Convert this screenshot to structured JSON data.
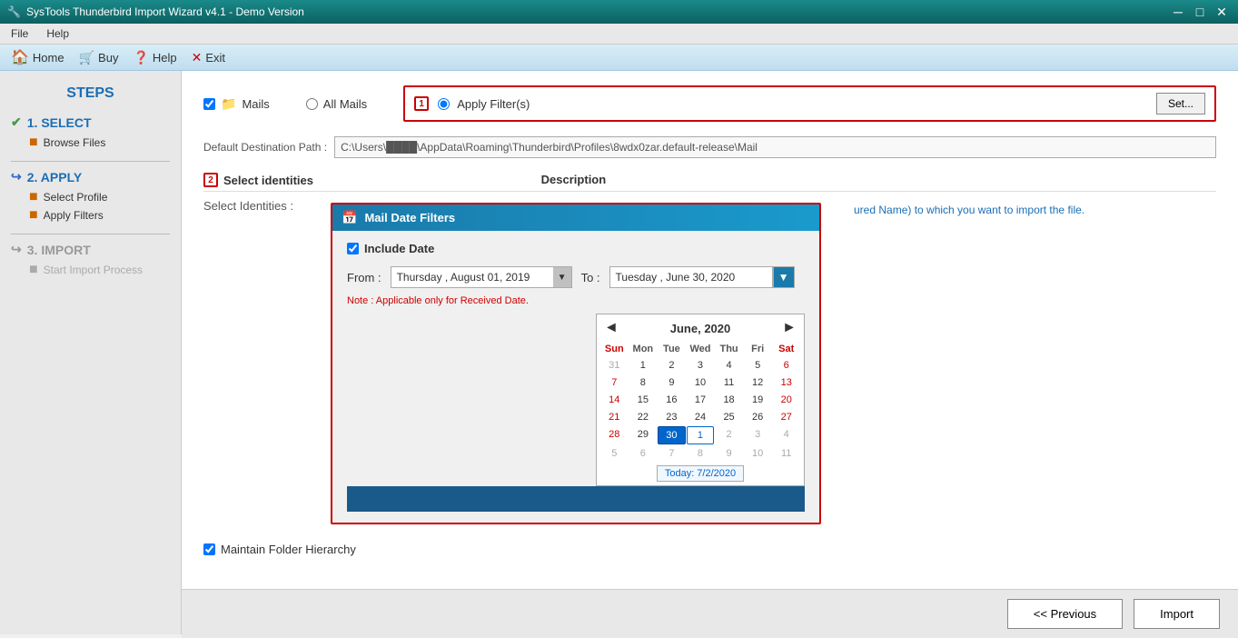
{
  "titleBar": {
    "title": "SysTools Thunderbird Import Wizard v4.1 - Demo Version",
    "controls": [
      "minimize",
      "maximize",
      "close"
    ]
  },
  "menuBar": {
    "items": [
      "File",
      "Help"
    ]
  },
  "toolbar": {
    "home_label": "Home",
    "buy_label": "Buy",
    "help_label": "Help",
    "exit_label": "Exit"
  },
  "sidebar": {
    "steps_title": "STEPS",
    "step1": {
      "number": "1.",
      "label": "SELECT",
      "sub_items": [
        "Browse Files"
      ]
    },
    "step2": {
      "number": "2.",
      "label": "APPLY",
      "sub_items": [
        "Select Profile",
        "Apply Filters"
      ]
    },
    "step3": {
      "number": "3.",
      "label": "IMPORT",
      "sub_items": [
        "Start Import Process"
      ]
    }
  },
  "content": {
    "options": {
      "mails_label": "Mails",
      "all_mails_label": "All Mails",
      "apply_filters_label": "Apply Filter(s)",
      "set_button_label": "Set...",
      "badge1": "1"
    },
    "path": {
      "label": "Default Destination Path :",
      "value": "C:\\Users\\████\\AppData\\Roaming\\Thunderbird\\Profiles\\8wdx0zar.default-release\\Mail"
    },
    "identities": {
      "col1": "Select identities",
      "col2": "Description",
      "badge2": "2",
      "select_identities_label": "Select Identities :",
      "description_text": "ured Name) to which you want to import the file."
    },
    "dialog": {
      "title": "Mail Date Filters",
      "include_date_label": "Include Date",
      "from_label": "From :",
      "from_value": "Thursday ,  August  01, 2019",
      "to_label": "To :",
      "to_value": "Tuesday ,  June  30, 2020",
      "note": "Note : Applicable only for Received Date.",
      "calendar": {
        "month_label": "June, 2020",
        "prev_arrow": "◄",
        "next_arrow": "►",
        "day_headers": [
          "Sun",
          "Mon",
          "Tue",
          "Wed",
          "Thu",
          "Fri",
          "Sat"
        ],
        "weeks": [
          [
            {
              "day": "31",
              "other": true
            },
            {
              "day": "1"
            },
            {
              "day": "2"
            },
            {
              "day": "3"
            },
            {
              "day": "4"
            },
            {
              "day": "5"
            },
            {
              "day": "6",
              "sat": true
            }
          ],
          [
            {
              "day": "7"
            },
            {
              "day": "8"
            },
            {
              "day": "9"
            },
            {
              "day": "10"
            },
            {
              "day": "11"
            },
            {
              "day": "12"
            },
            {
              "day": "13",
              "sat": true
            }
          ],
          [
            {
              "day": "14"
            },
            {
              "day": "15"
            },
            {
              "day": "16"
            },
            {
              "day": "17"
            },
            {
              "day": "18"
            },
            {
              "day": "19"
            },
            {
              "day": "20",
              "sat": true
            }
          ],
          [
            {
              "day": "21"
            },
            {
              "day": "22"
            },
            {
              "day": "23"
            },
            {
              "day": "24"
            },
            {
              "day": "25"
            },
            {
              "day": "26"
            },
            {
              "day": "27",
              "sat": true
            }
          ],
          [
            {
              "day": "28"
            },
            {
              "day": "29"
            },
            {
              "day": "30",
              "selected": true
            },
            {
              "day": "1",
              "other": true,
              "today_box": true
            },
            {
              "day": "2",
              "other": true
            },
            {
              "day": "3",
              "other": true
            },
            {
              "day": "4",
              "other": true,
              "sat": true
            }
          ],
          [
            {
              "day": "5",
              "other": true
            },
            {
              "day": "6",
              "other": true
            },
            {
              "day": "7",
              "other": true
            },
            {
              "day": "8",
              "other": true
            },
            {
              "day": "9",
              "other": true
            },
            {
              "day": "10",
              "other": true
            },
            {
              "day": "11",
              "other": true,
              "sat": true
            }
          ]
        ],
        "today_label": "Today: 7/2/2020"
      }
    },
    "maintain_folder": {
      "label": "Maintain Folder Hierarchy"
    }
  },
  "bottom": {
    "previous_label": "<< Previous",
    "import_label": "Import"
  }
}
